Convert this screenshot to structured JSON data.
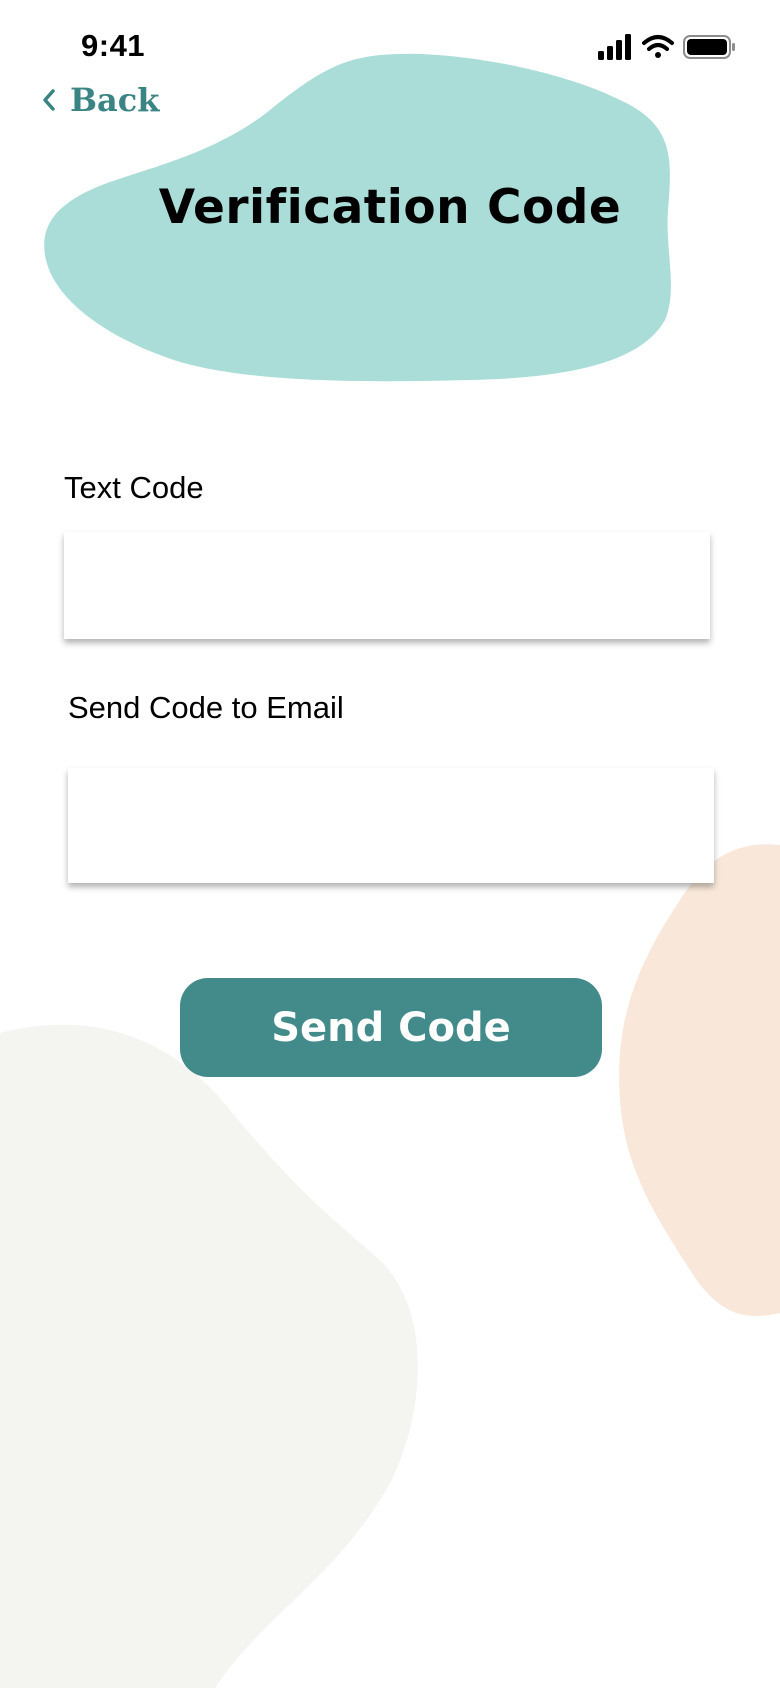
{
  "status_bar": {
    "time": "9:41",
    "icons": [
      "cellular-signal-icon",
      "wifi-icon",
      "battery-icon"
    ]
  },
  "nav": {
    "back_label": "Back",
    "back_icon": "chevron-left-icon"
  },
  "page": {
    "title": "Verification Code"
  },
  "form": {
    "text_code_label": "Text Code",
    "text_code_value": "",
    "email_label": "Send Code to Email",
    "email_value": "",
    "submit_label": "Send Code"
  },
  "colors": {
    "title_blob": "#aaddd8",
    "accent": "#438b8b",
    "back_text": "#3a8484",
    "peach_blob": "#f9e8da",
    "gray_blob": "#f4f4f0"
  }
}
